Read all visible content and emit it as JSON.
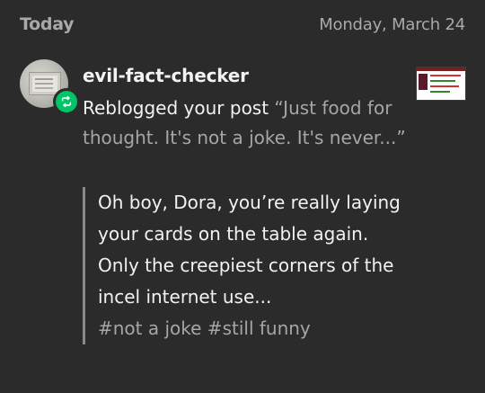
{
  "header": {
    "day": "Today",
    "date": "Monday, March 24"
  },
  "notification": {
    "username": "evil-fact-checker",
    "action": "Reblogged your post",
    "post_title": "“Just food for thought. It's not a joke. It's never...”",
    "quote": {
      "body": "Oh boy, Dora, you’re really laying your cards on the table again.  Only the creepiest corners of the incel internet use...",
      "tags": "#not a joke #still funny"
    },
    "icons": {
      "badge": "reblog-icon",
      "avatar": "avatar",
      "thumbnail": "post-thumbnail"
    },
    "colors": {
      "badge": "#00c468",
      "background": "#2b2b2b",
      "muted_text": "#a6a6a6"
    }
  }
}
